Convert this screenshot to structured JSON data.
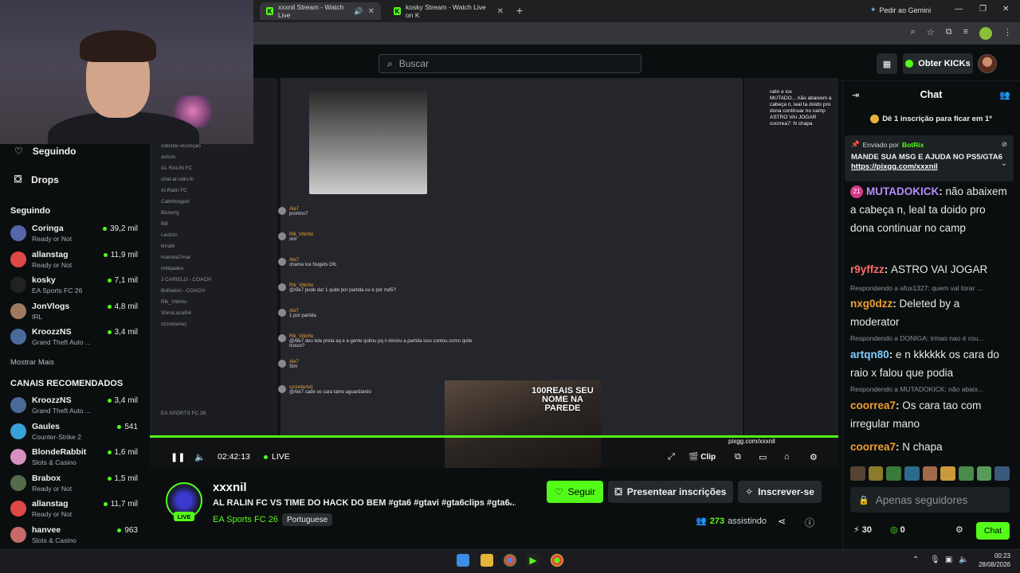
{
  "browser": {
    "tabs": [
      {
        "title": "xxxnil Stream - Watch Live",
        "audio_icon": "speaker-icon"
      },
      {
        "title": "kosky Stream - Watch Live on K"
      }
    ],
    "gemini_label": "Pedir ao Gemini"
  },
  "header": {
    "search_placeholder": "Buscar",
    "kicks_label": "Obter KICKs"
  },
  "sidebar": {
    "nav": [
      {
        "label": "Seguindo",
        "icon": "heart-icon"
      },
      {
        "label": "Drops",
        "icon": "gift-icon"
      }
    ],
    "following_title": "Seguindo",
    "following": [
      {
        "name": "Coringa",
        "game": "Ready or Not",
        "viewers": "39,2 mil",
        "color": "#5566aa"
      },
      {
        "name": "allanstag",
        "game": "Ready or Not",
        "viewers": "11,9 mil",
        "color": "#e04848"
      },
      {
        "name": "kosky",
        "game": "EA Sports FC 26",
        "viewers": "7,1 mil",
        "color": "#222222"
      },
      {
        "name": "JonVlogs",
        "game": "IRL",
        "viewers": "4,8 mil",
        "color": "#a07a60"
      },
      {
        "name": "KroozzNS",
        "game": "Grand Theft Auto ...",
        "viewers": "3,4 mil",
        "color": "#4a6a9a"
      }
    ],
    "show_more": "Mostrar Mais",
    "recommended_title": "CANAIS RECOMENDADOS",
    "recommended": [
      {
        "name": "KroozzNS",
        "game": "Grand Theft Auto ...",
        "viewers": "3,4 mil",
        "color": "#4a6a9a"
      },
      {
        "name": "Gaules",
        "game": "Counter-Strike 2",
        "viewers": "541",
        "color": "#3aa0d8"
      },
      {
        "name": "BlondeRabbit",
        "game": "Slots & Casino",
        "viewers": "1,6 mil",
        "color": "#d890c0"
      },
      {
        "name": "Brabox",
        "game": "Ready or Not",
        "viewers": "1,5 mil",
        "color": "#556b4a"
      },
      {
        "name": "allanstag",
        "game": "Ready or Not",
        "viewers": "11,7 mil",
        "color": "#e04848"
      },
      {
        "name": "hanvee",
        "game": "Slots & Casino",
        "viewers": "963",
        "color": "#c86a6a"
      }
    ]
  },
  "video": {
    "time": "02:42:13",
    "live_label": "LIVE",
    "clip_label": "Clip",
    "overlay_url": "pixgg.com/xxxnil",
    "streamer_overlay_text": "100REAIS SEU NOME NA PAREDE",
    "progress_fraction": 1.0,
    "discord_channels": [
      "solicitar-inscrição",
      "avisos",
      "AL RALIN FC",
      "chat-al-ralin-fc",
      "Al Ralin FC",
      "Cabritosgod",
      "Bezerrg",
      "Bill",
      "Leolzin",
      "linrabi",
      "marreta7mar",
      "mitiqadeu",
      "J CARIELO - COACH",
      "Bolhatori - COACH",
      "Rlk_Vitinho",
      "ShiroLocal04",
      "szcretariorj",
      "EA SPORTS FC 26"
    ],
    "discord_messages": [
      {
        "user": "Ale7",
        "text": "prontos?"
      },
      {
        "user": "Rlk_Vitinho",
        "text": "sim"
      },
      {
        "user": "Ale7",
        "text": "chama Ice Nugets Ofc"
      },
      {
        "user": "Rlk_Vitinho",
        "text": "@Ale7 pode dar 1 quite por partida ou é por md5?"
      },
      {
        "user": "Ale7",
        "text": "1 por partida"
      },
      {
        "user": "Rlk_Vitinho",
        "text": "@Ale7 deu tela preta aq e a gente quitou pq n iniciou a partida isso contou como quite nosso?"
      },
      {
        "user": "Ale7",
        "text": "Sim"
      },
      {
        "user": "szcretariorj",
        "text": "@Ale7 cade os cara tamo aguardando"
      }
    ],
    "overlay_chat": "ralin e ice\nMUTADO... não abaixem a cabeça n, leal ta doido pro dona continuar no camp\nASTRO VAI JOGAR\ncoorrea7: N chapa"
  },
  "channel": {
    "name": "xxxnil",
    "live_badge": "LIVE",
    "title": "AL RALIN FC VS TIME DO HACK DO BEM #gta6 #gtavi #gta6clips #gta6...",
    "category": "EA Sports FC 26",
    "language": "Portuguese",
    "follow_label": "Seguir",
    "gift_label": "Presentear inscrições",
    "subscribe_label": "Inscrever-se",
    "viewers_count": "273",
    "viewers_label": "assistindo"
  },
  "chat": {
    "title": "Chat",
    "sub_banner": "Dê 1 inscrição para ficar em 1º",
    "pinned": {
      "sent_by": "Enviado por",
      "sender": "BotRix",
      "message": "MANDE SUA MSG E AJUDA NO PS5/GTA6",
      "link": "https://pixgg.com/xxxnil"
    },
    "messages": [
      {
        "badge": "21",
        "user": "MUTADOKICK",
        "color": "#b98cff",
        "text": "não abaixem a cabeça n, leal ta doido pro dona continuar no camp"
      },
      {
        "user": "r9yffzz",
        "color": "#ff6a6a",
        "text": "ASTRO VAI JOGAR"
      },
      {
        "reply": "Respondendo a afus1327: quem val torar ..."
      },
      {
        "user": "nxg0dzz",
        "color": "#f0a030",
        "text": "Deleted by a moderator"
      },
      {
        "reply": "Respondendo a DONIGA: irmao nao é rou..."
      },
      {
        "user": "artqn80",
        "color": "#7ad0ff",
        "text": "e n kkkkkk os cara do raio x falou que podia"
      },
      {
        "reply": "Respondendo a MUTADOKICK: não abaix..."
      },
      {
        "user": "coorrea7",
        "color": "#f0a030",
        "text": "Os cara tao com irregular mano"
      },
      {
        "user": "coorrea7",
        "color": "#f0a030",
        "text": "N chapa"
      }
    ],
    "input_placeholder": "Apenas seguidores",
    "kicks_count": "30",
    "points_count": "0",
    "chat_button": "Chat"
  },
  "taskbar": {
    "time": "00:23",
    "date": "28/08/2026"
  }
}
